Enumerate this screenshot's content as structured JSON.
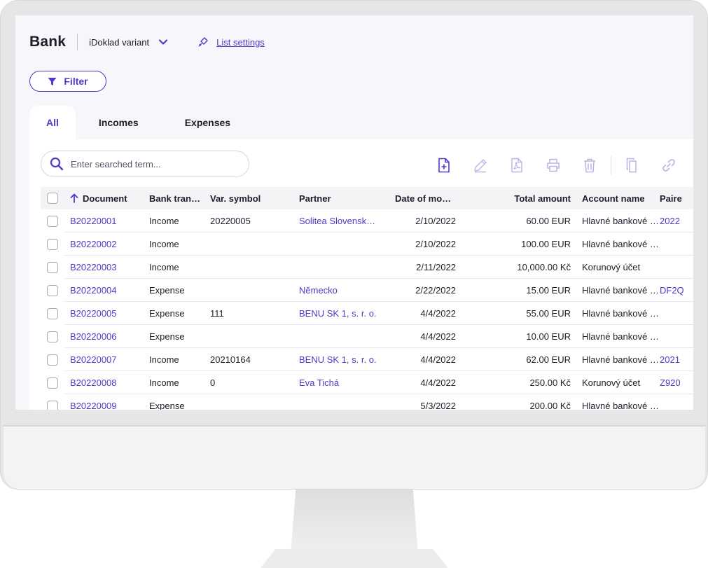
{
  "header": {
    "title": "Bank",
    "variant": "iDoklad variant",
    "list_settings": "List settings"
  },
  "filter": {
    "label": "Filter"
  },
  "tabs": [
    {
      "label": "All",
      "active": true
    },
    {
      "label": "Incomes",
      "active": false
    },
    {
      "label": "Expenses",
      "active": false
    }
  ],
  "search": {
    "placeholder": "Enter searched term..."
  },
  "toolbar": {
    "icons": [
      "new-document-icon",
      "edit-icon",
      "pdf-icon",
      "print-icon",
      "delete-icon",
      "copy-icon",
      "link-icon"
    ]
  },
  "table": {
    "columns": {
      "document": "Document",
      "bank_transaction": "Bank tran…",
      "var_symbol": "Var. symbol",
      "partner": "Partner",
      "date": "Date of move…",
      "total": "Total amount",
      "account": "Account name",
      "paired": "Paire"
    },
    "rows": [
      {
        "document": "B20220001",
        "type": "Income",
        "var_symbol": "20220005",
        "partner": "Solitea Slovensk…",
        "date": "2/10/2022",
        "total": "60.00 EUR",
        "account": "Hlavné bankové …",
        "paired": "2022"
      },
      {
        "document": "B20220002",
        "type": "Income",
        "var_symbol": "",
        "partner": "",
        "date": "2/10/2022",
        "total": "100.00 EUR",
        "account": "Hlavné bankové …",
        "paired": ""
      },
      {
        "document": "B20220003",
        "type": "Income",
        "var_symbol": "",
        "partner": "",
        "date": "2/11/2022",
        "total": "10,000.00 Kč",
        "account": "Korunový účet",
        "paired": ""
      },
      {
        "document": "B20220004",
        "type": "Expense",
        "var_symbol": "",
        "partner": "Německo",
        "date": "2/22/2022",
        "total": "15.00 EUR",
        "account": "Hlavné bankové …",
        "paired": "DF2Q"
      },
      {
        "document": "B20220005",
        "type": "Expense",
        "var_symbol": "111",
        "partner": "BENU SK 1, s. r. o.",
        "date": "4/4/2022",
        "total": "55.00 EUR",
        "account": "Hlavné bankové …",
        "paired": ""
      },
      {
        "document": "B20220006",
        "type": "Expense",
        "var_symbol": "",
        "partner": "",
        "date": "4/4/2022",
        "total": "10.00 EUR",
        "account": "Hlavné bankové …",
        "paired": ""
      },
      {
        "document": "B20220007",
        "type": "Income",
        "var_symbol": "20210164",
        "partner": "BENU SK 1, s. r. o.",
        "date": "4/4/2022",
        "total": "62.00 EUR",
        "account": "Hlavné bankové …",
        "paired": "2021"
      },
      {
        "document": "B20220008",
        "type": "Income",
        "var_symbol": "0",
        "partner": "Eva Tichá",
        "date": "4/4/2022",
        "total": "250.00 Kč",
        "account": "Korunový účet",
        "paired": "Z920"
      },
      {
        "document": "B20220009",
        "type": "Expense",
        "var_symbol": "",
        "partner": "",
        "date": "5/3/2022",
        "total": "200.00 Kč",
        "account": "Hlavné bankové …",
        "paired": ""
      }
    ]
  },
  "colors": {
    "accent": "#4b3bc8",
    "icon_muted": "#b9b3e6"
  }
}
